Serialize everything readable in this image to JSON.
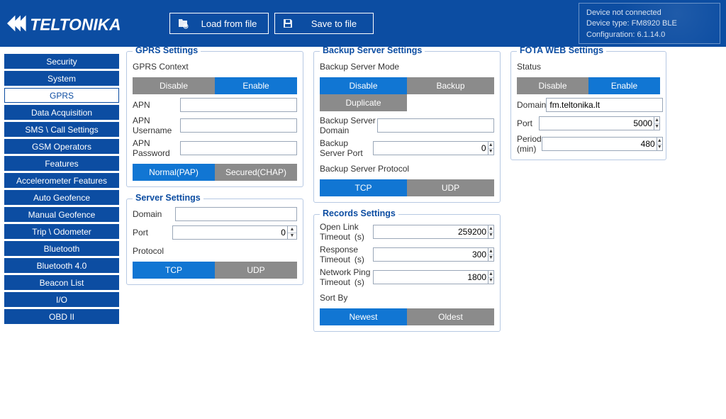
{
  "header": {
    "brand": "TELTONIKA",
    "load_btn": "Load from file",
    "save_btn": "Save to file",
    "status": {
      "line1": "Device not connected",
      "line2": "Device type: FM8920 BLE",
      "line3": "Configuration: 6.1.14.0"
    }
  },
  "sidebar": {
    "items": [
      "Security",
      "System",
      "GPRS",
      "Data Acquisition",
      "SMS \\ Call Settings",
      "GSM Operators",
      "Features",
      "Accelerometer Features",
      "Auto Geofence",
      "Manual Geofence",
      "Trip \\ Odometer",
      "Bluetooth",
      "Bluetooth 4.0",
      "Beacon List",
      "I/O",
      "OBD II"
    ],
    "active_index": 2
  },
  "gprs": {
    "title": "GPRS Settings",
    "context_label": "GPRS Context",
    "context_options": [
      "Disable",
      "Enable"
    ],
    "context_selected": 1,
    "apn_label": "APN",
    "apn_value": "",
    "apn_user_label": "APN Username",
    "apn_user_value": "",
    "apn_pass_label": "APN Password",
    "apn_pass_value": "",
    "auth_options": [
      "Normal(PAP)",
      "Secured(CHAP)"
    ],
    "auth_selected": 0
  },
  "server": {
    "title": "Server Settings",
    "domain_label": "Domain",
    "domain_value": "",
    "port_label": "Port",
    "port_value": "0",
    "protocol_label": "Protocol",
    "protocol_options": [
      "TCP",
      "UDP"
    ],
    "protocol_selected": 0
  },
  "backup": {
    "title": "Backup Server Settings",
    "mode_label": "Backup Server Mode",
    "mode_options": [
      "Disable",
      "Backup",
      "Duplicate"
    ],
    "mode_selected": 0,
    "domain_label": "Backup Server Domain",
    "domain_value": "",
    "port_label": "Backup Server Port",
    "port_value": "0",
    "protocol_label": "Backup Server Protocol",
    "protocol_options": [
      "TCP",
      "UDP"
    ],
    "protocol_selected": 0
  },
  "records": {
    "title": "Records Settings",
    "open_link_label": "Open Link Timeout",
    "open_link_unit": "(s)",
    "open_link_value": "259200",
    "response_label": "Response Timeout",
    "response_unit": "(s)",
    "response_value": "300",
    "ping_label": "Network Ping Timeout",
    "ping_unit": "(s)",
    "ping_value": "1800",
    "sort_label": "Sort By",
    "sort_options": [
      "Newest",
      "Oldest"
    ],
    "sort_selected": 0
  },
  "fota": {
    "title": "FOTA WEB Settings",
    "status_label": "Status",
    "status_options": [
      "Disable",
      "Enable"
    ],
    "status_selected": 1,
    "domain_label": "Domain",
    "domain_value": "fm.teltonika.lt",
    "port_label": "Port",
    "port_value": "5000",
    "period_label": "Period (min)",
    "period_value": "480"
  }
}
